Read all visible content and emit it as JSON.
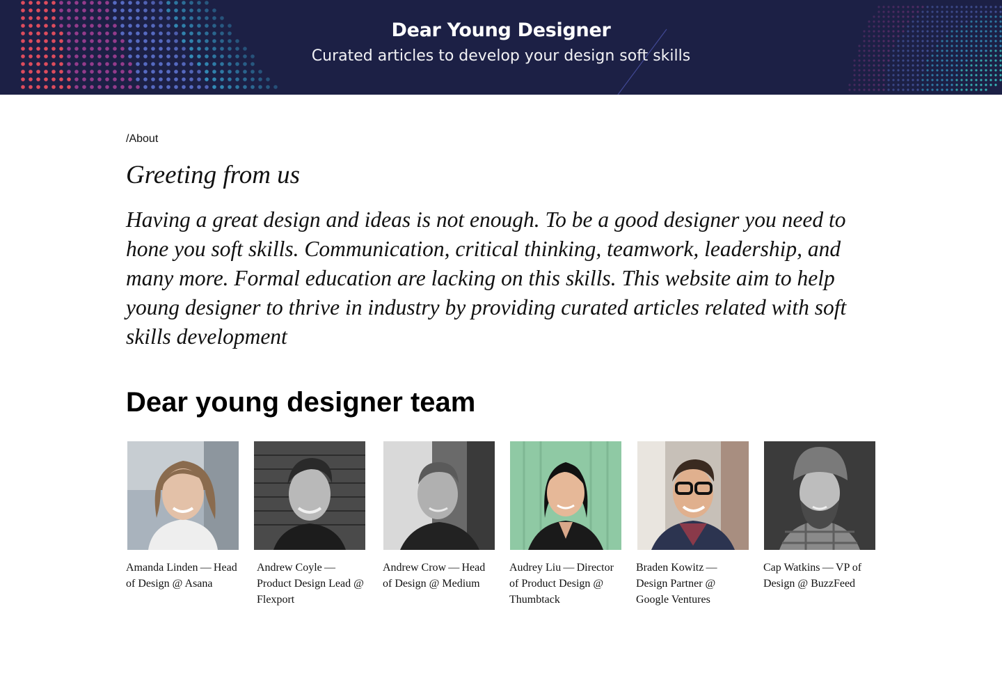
{
  "banner": {
    "title": "Dear Young Designer",
    "subtitle": "Curated articles to develop your design soft skills",
    "background_color": "#1c2045",
    "dot_colors": [
      "#e94f5f",
      "#9a3d8f",
      "#5a6fc8",
      "#39a9d6",
      "#3cc9c5"
    ]
  },
  "breadcrumb": "/About",
  "greeting": "Greeting from us",
  "intro": "Having a great design and ideas is not enough. To be a good designer you need to hone you soft skills. Communication, critical thinking, teamwork, leadership, and many more. Formal education are lacking on this skills. This website aim to help young designer to thrive in industry by providing curated articles related with soft skills development",
  "team_title": "Dear young designer team",
  "team": [
    {
      "caption": "Amanda Linden — Head of Design @ Asana"
    },
    {
      "caption": "Andrew Coyle — Product Design Lead @ Flexport"
    },
    {
      "caption": "Andrew Crow — Head of Design @ Medium"
    },
    {
      "caption": "Audrey Liu — Director of Product Design @ Thumbtack"
    },
    {
      "caption": "Braden Kowitz — Design Partner @ Google Ventures"
    },
    {
      "caption": "Cap Watkins — VP of Design @ BuzzFeed"
    }
  ]
}
